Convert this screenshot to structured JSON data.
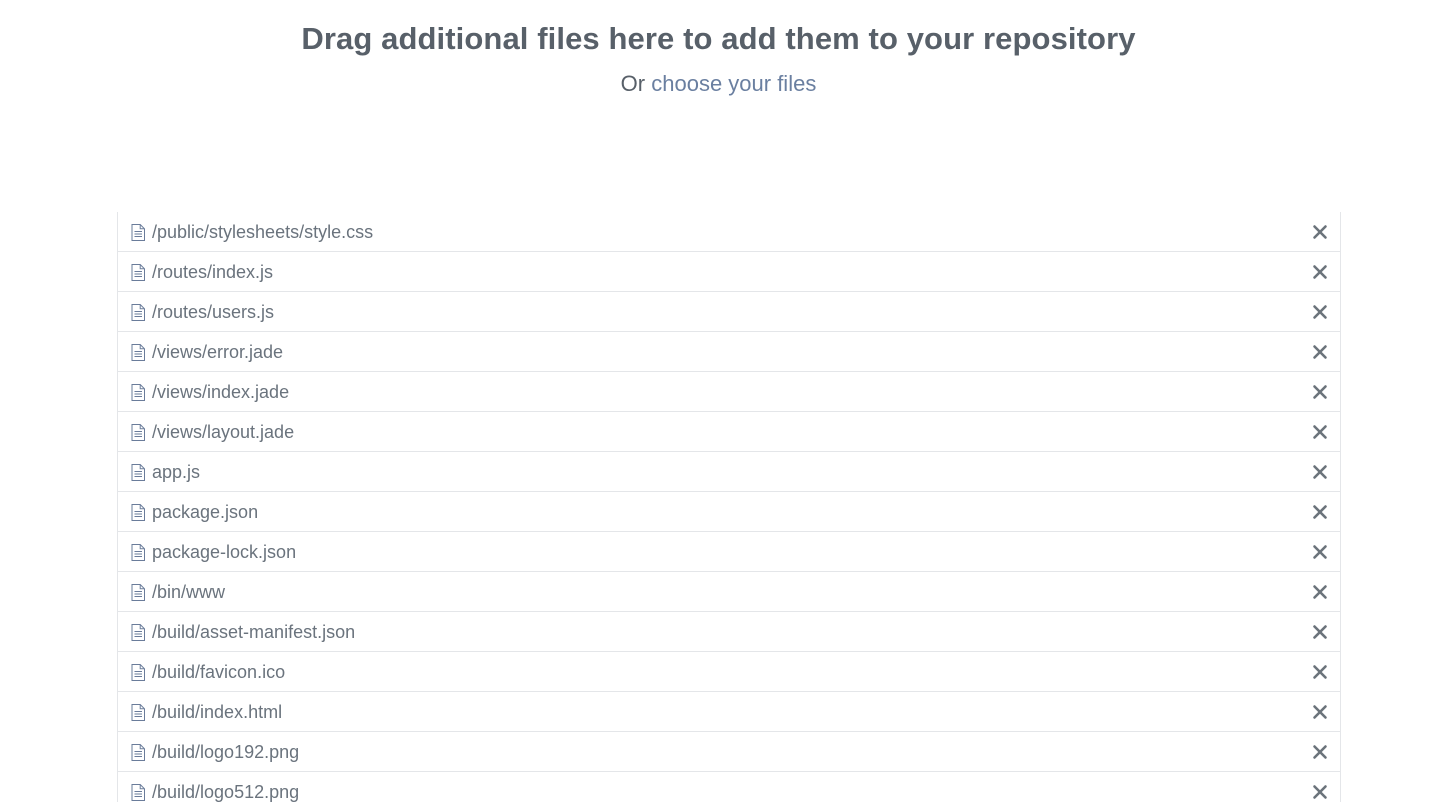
{
  "header": {
    "title": "Drag additional files here to add them to your repository",
    "prefix": "Or",
    "link_label": "choose your files"
  },
  "files": [
    {
      "name": "/public/stylesheets/style.css"
    },
    {
      "name": "/routes/index.js"
    },
    {
      "name": "/routes/users.js"
    },
    {
      "name": "/views/error.jade"
    },
    {
      "name": "/views/index.jade"
    },
    {
      "name": "/views/layout.jade"
    },
    {
      "name": "app.js"
    },
    {
      "name": "package.json"
    },
    {
      "name": "package-lock.json"
    },
    {
      "name": "/bin/www"
    },
    {
      "name": "/build/asset-manifest.json"
    },
    {
      "name": "/build/favicon.ico"
    },
    {
      "name": "/build/index.html"
    },
    {
      "name": "/build/logo192.png"
    },
    {
      "name": "/build/logo512.png"
    }
  ],
  "icons": {
    "file": "file-icon",
    "remove": "close-icon"
  },
  "colors": {
    "heading": "#586069",
    "link": "#6a7fa0",
    "file_text": "#6a737d",
    "icon": "#6a7c9a",
    "close": "#6b737b",
    "border": "#e4e6e9"
  }
}
